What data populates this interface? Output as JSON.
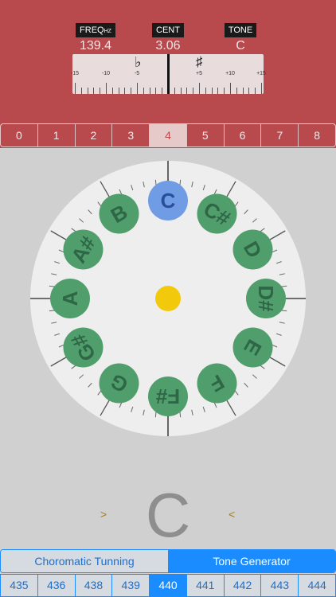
{
  "readouts": {
    "freq": {
      "label": "FREQ",
      "unit": "HZ",
      "value": "139.4"
    },
    "cent": {
      "label": "CENT",
      "value": "3.06"
    },
    "tone": {
      "label": "TONE",
      "value": "C"
    }
  },
  "scale": {
    "flat": "♭",
    "sharp": "♯",
    "labels": [
      "-15",
      "-10",
      "-5",
      "",
      "+5",
      "+10",
      "+15"
    ]
  },
  "octaves": [
    "0",
    "1",
    "2",
    "3",
    "4",
    "5",
    "6",
    "7",
    "8"
  ],
  "selected_octave": "4",
  "wheel": {
    "notes": [
      "C",
      "C#",
      "D",
      "D#",
      "E",
      "F",
      "F#",
      "G",
      "G#",
      "A",
      "A#",
      "B"
    ],
    "active": "C",
    "colors": {
      "note": "#4f9e6c",
      "note_text": "#2f6646",
      "active": "#6f9ce4",
      "active_text": "#2a4e98",
      "center": "#f3c90c",
      "dial": "#eeeeee"
    }
  },
  "current_note": "C",
  "arrows": {
    "left": ">",
    "right": "<"
  },
  "modes": {
    "chromatic": "Choromatic Tunning",
    "generator": "Tone Generator",
    "active": "generator"
  },
  "reference": {
    "values": [
      "435",
      "436",
      "438",
      "439",
      "440",
      "441",
      "442",
      "443",
      "444"
    ],
    "selected": "440"
  }
}
